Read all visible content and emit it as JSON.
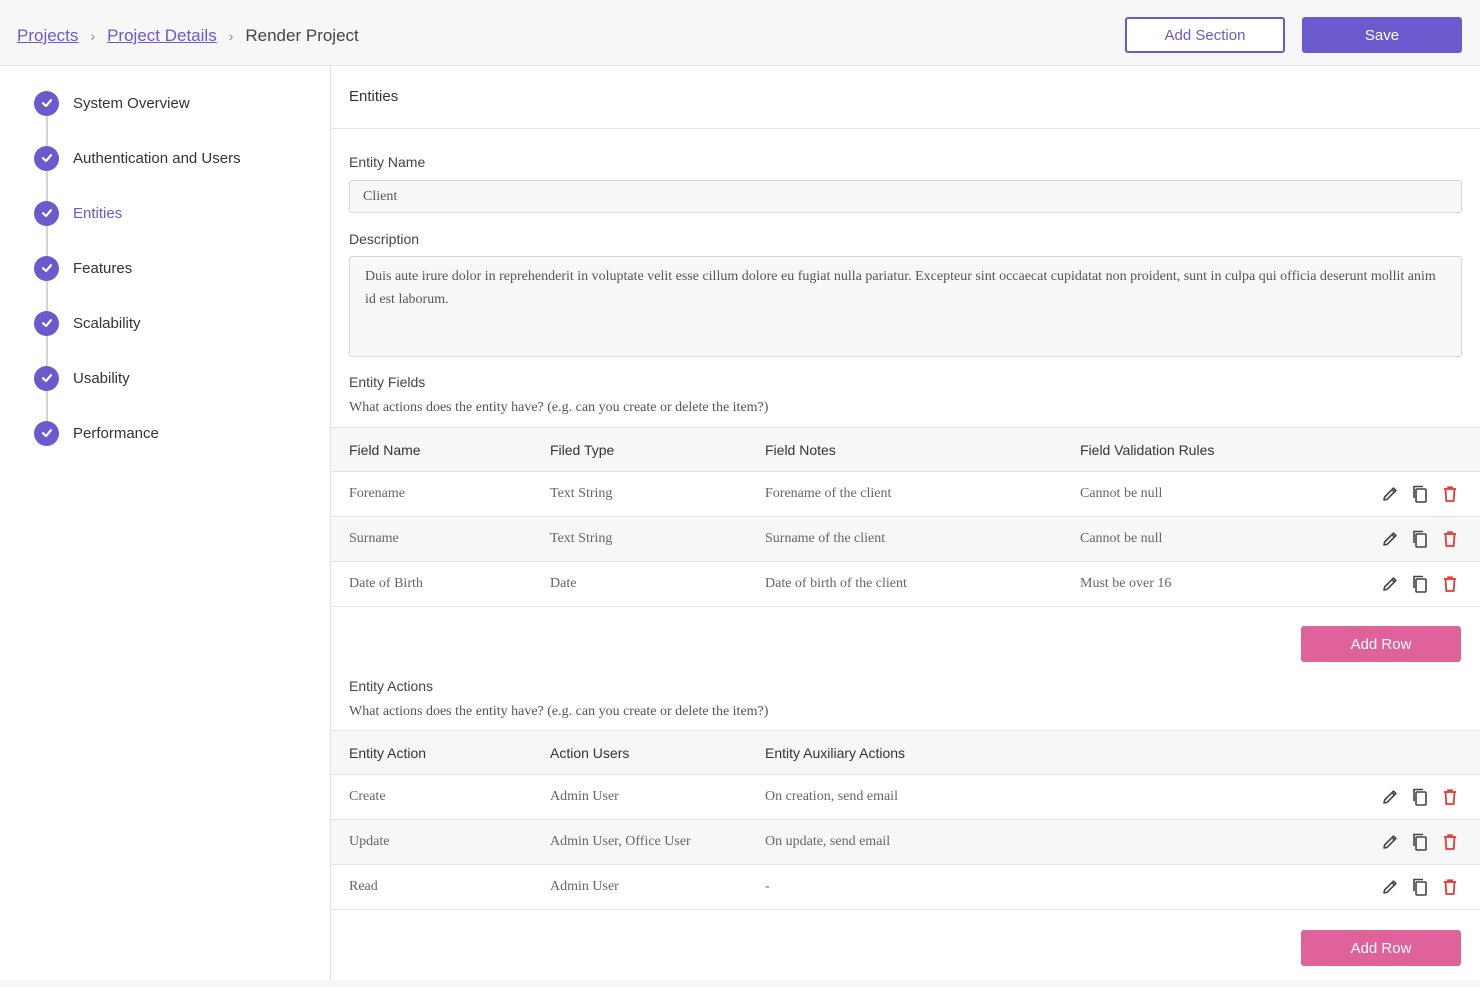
{
  "header": {
    "breadcrumb": {
      "projects": "Projects",
      "project_details": "Project Details",
      "current": "Render Project"
    },
    "add_section_label": "Add Section",
    "save_label": "Save"
  },
  "sidebar": {
    "steps": [
      {
        "label": "System Overview",
        "active": false
      },
      {
        "label": "Authentication and Users",
        "active": false
      },
      {
        "label": "Entities",
        "active": true
      },
      {
        "label": "Features",
        "active": false
      },
      {
        "label": "Scalability",
        "active": false
      },
      {
        "label": "Usability",
        "active": false
      },
      {
        "label": "Performance",
        "active": false
      }
    ]
  },
  "main": {
    "section_title": "Entities",
    "entity_name": {
      "label": "Entity Name",
      "value": "Client"
    },
    "description": {
      "label": "Description",
      "value": "Duis aute irure dolor in reprehenderit in voluptate velit esse cillum dolore eu fugiat nulla pariatur. Excepteur sint occaecat cupidatat non proident, sunt in culpa qui officia deserunt mollit anim id est laborum."
    },
    "entity_fields": {
      "title": "Entity Fields",
      "help": "What actions does the entity have? (e.g. can you create or delete the item?)",
      "columns": [
        "Field Name",
        "Filed Type",
        "Field Notes",
        "Field Validation Rules"
      ],
      "rows": [
        [
          "Forename",
          "Text String",
          "Forename of the client",
          "Cannot be null"
        ],
        [
          "Surname",
          "Text String",
          "Surname of the client",
          "Cannot be null"
        ],
        [
          "Date of Birth",
          "Date",
          "Date of birth of the client",
          "Must be over 16"
        ]
      ],
      "add_row_label": "Add Row"
    },
    "entity_actions": {
      "title": "Entity Actions",
      "help": "What actions does the entity have? (e.g. can you create or delete the item?)",
      "columns": [
        "Entity Action",
        "Action Users",
        "Entity Auxiliary Actions"
      ],
      "rows": [
        [
          "Create",
          "Admin User",
          "On creation, send email"
        ],
        [
          "Update",
          "Admin User, Office User",
          "On update, send email"
        ],
        [
          "Read",
          "Admin User",
          "-"
        ]
      ],
      "add_row_label": "Add Row"
    }
  },
  "colors": {
    "accent": "#6a5acd",
    "pink": "#e0629a",
    "delete": "#e53935"
  },
  "icons": {
    "step": "check-circle-icon",
    "edit": "pencil-icon",
    "copy": "copy-icon",
    "delete": "trash-icon",
    "breadcrumb_sep": "chevron-right-icon"
  }
}
